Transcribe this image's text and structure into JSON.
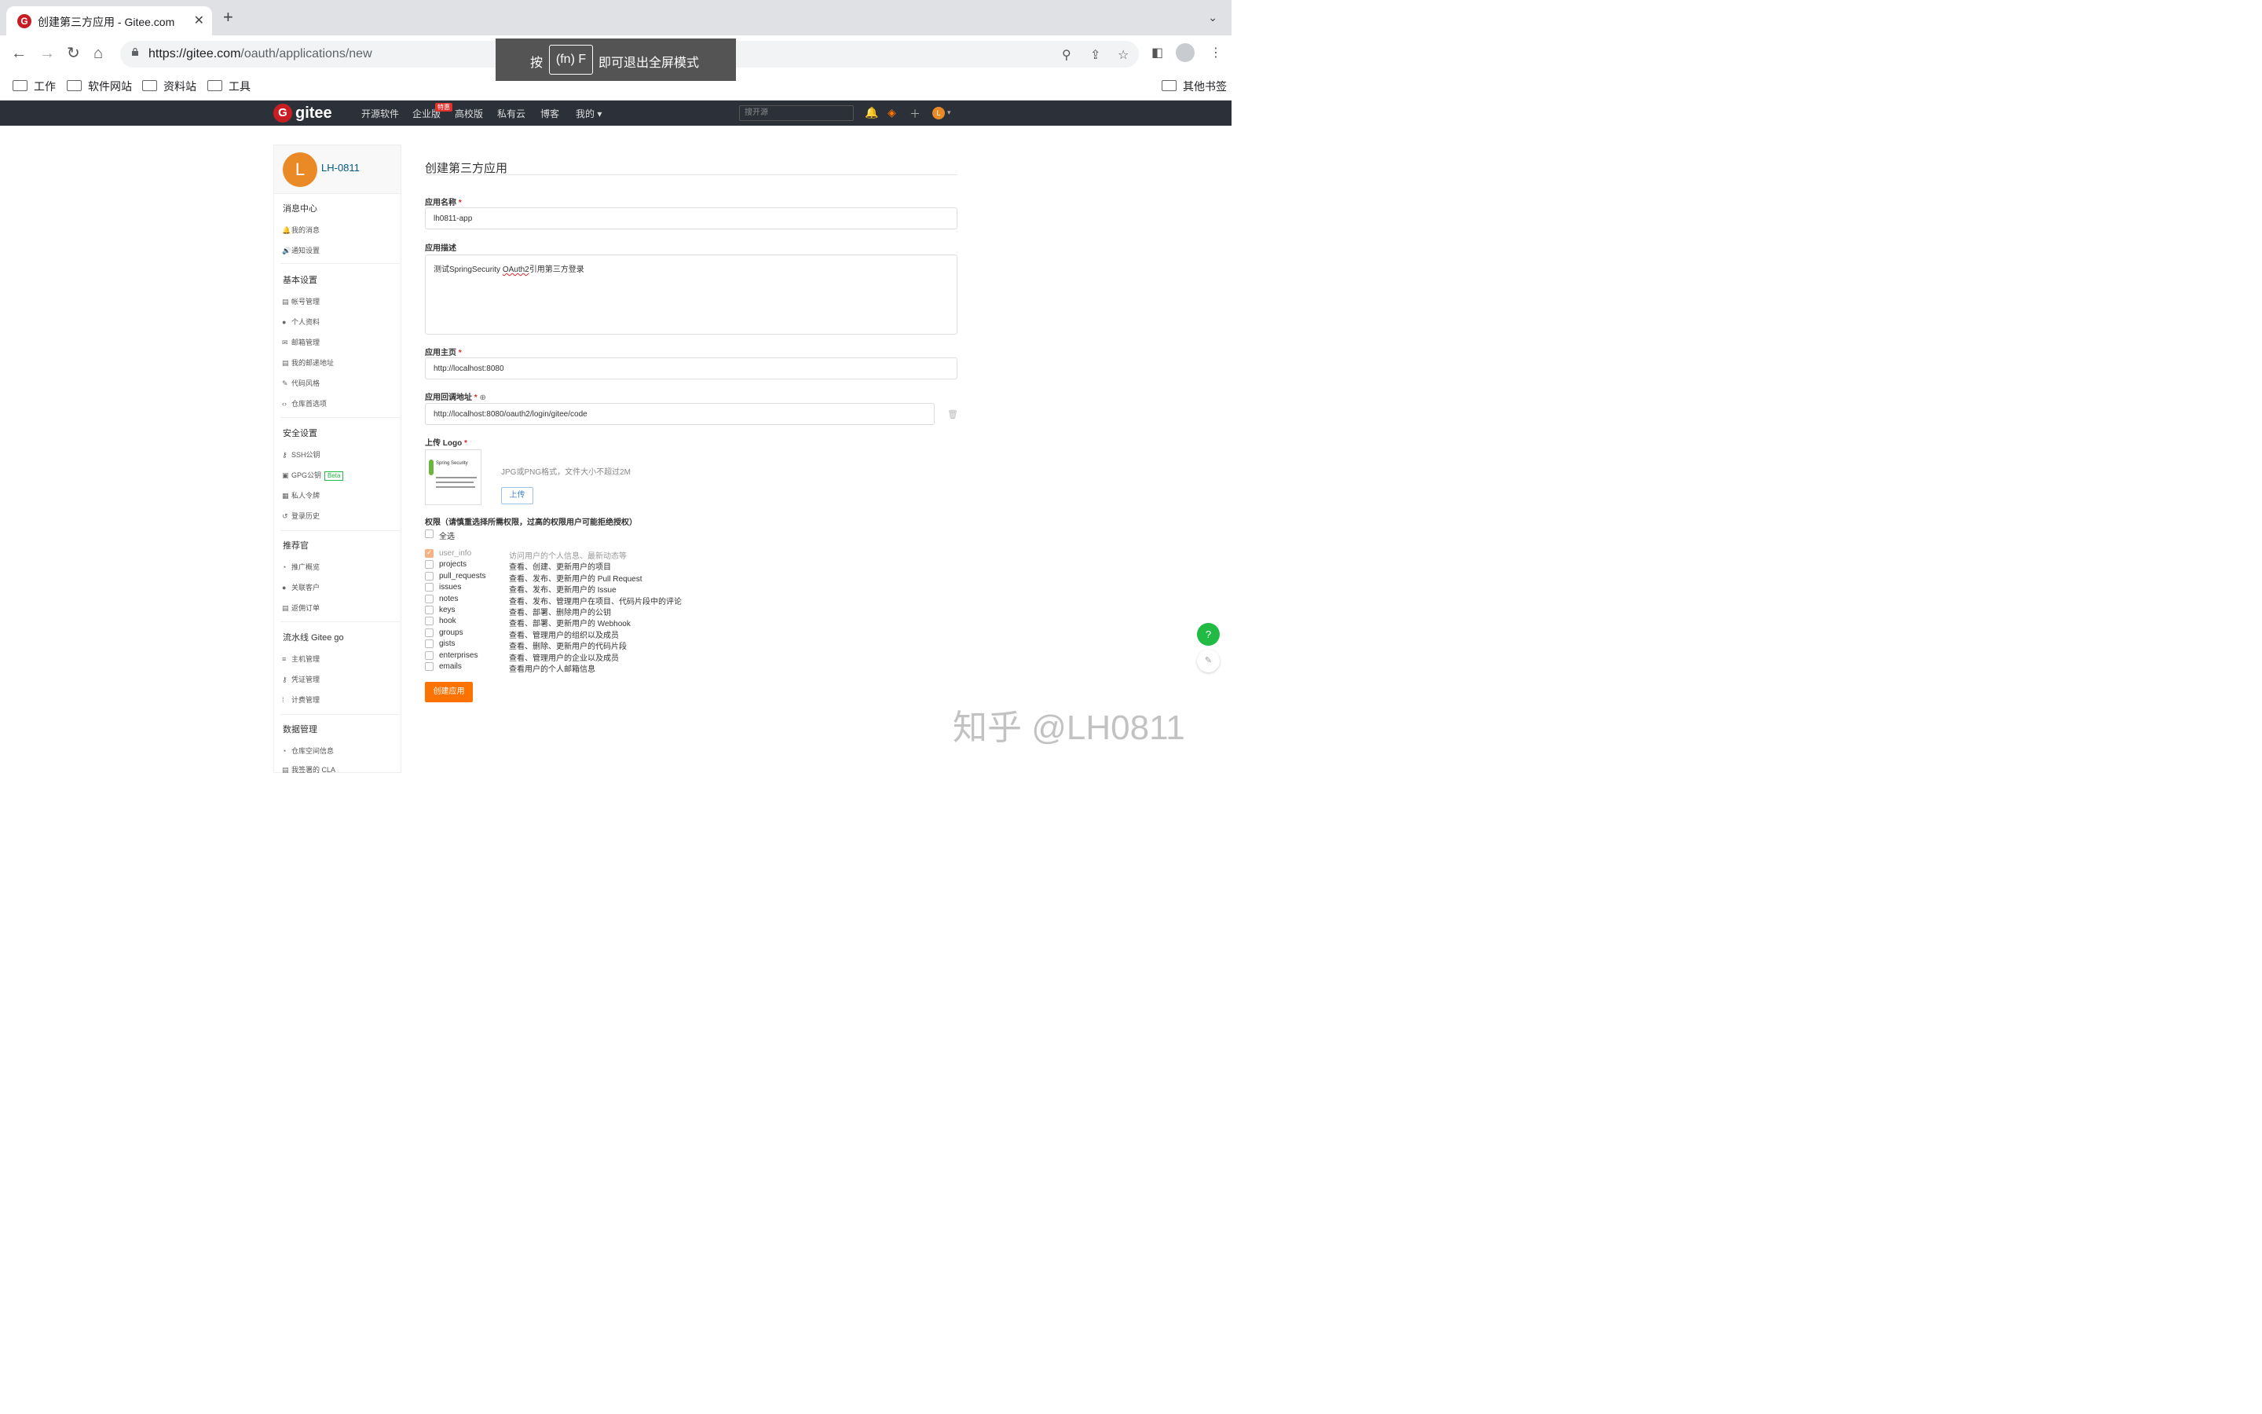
{
  "browser": {
    "tab_title": "创建第三方应用 - Gitee.com",
    "url_host": "https://gitee.com",
    "url_path": "/oauth/applications/new",
    "bookmarks": [
      "工作",
      "软件网站",
      "资料站",
      "工具"
    ],
    "other_bookmarks": "其他书签",
    "fullscreen_prefix": "按",
    "fullscreen_key": "(fn) F",
    "fullscreen_suffix": "即可退出全屏模式"
  },
  "header": {
    "logo": "gitee",
    "nav": [
      "开源软件",
      "企业版",
      "高校版",
      "私有云",
      "博客",
      "我的"
    ],
    "hot_badge": "特惠",
    "search_placeholder": "搜开源",
    "avatar_letter": "L"
  },
  "sidebar": {
    "avatar_letter": "L",
    "username": "LH-0811",
    "sections": [
      {
        "title": "消息中心",
        "items": [
          {
            "icon": "bell-icon",
            "glyph": "🔔",
            "label": "我的消息"
          },
          {
            "icon": "speaker-icon",
            "glyph": "🔊",
            "label": "通知设置"
          }
        ]
      },
      {
        "title": "基本设置",
        "items": [
          {
            "icon": "idcard-icon",
            "glyph": "▤",
            "label": "帐号管理"
          },
          {
            "icon": "user-icon",
            "glyph": "●",
            "label": "个人资料"
          },
          {
            "icon": "mail-icon",
            "glyph": "✉",
            "label": "邮箱管理"
          },
          {
            "icon": "address-icon",
            "glyph": "▤",
            "label": "我的邮递地址"
          },
          {
            "icon": "brush-icon",
            "glyph": "✎",
            "label": "代码风格"
          },
          {
            "icon": "code-icon",
            "glyph": "‹›",
            "label": "仓库首选项"
          }
        ]
      },
      {
        "title": "安全设置",
        "items": [
          {
            "icon": "key-icon",
            "glyph": "⚷",
            "label": "SSH公钥"
          },
          {
            "icon": "lock-icon",
            "glyph": "▣",
            "label": "GPG公钥",
            "badge": "Beta"
          },
          {
            "icon": "token-icon",
            "glyph": "▦",
            "label": "私人令牌"
          },
          {
            "icon": "history-icon",
            "glyph": "↺",
            "label": "登录历史"
          }
        ]
      },
      {
        "title": "推荐官",
        "items": [
          {
            "icon": "chart-icon",
            "glyph": "◔",
            "label": "推广概览"
          },
          {
            "icon": "users-icon",
            "glyph": "●",
            "label": "关联客户"
          },
          {
            "icon": "order-icon",
            "glyph": "▤",
            "label": "返佣订单"
          }
        ]
      },
      {
        "title": "流水线 Gitee go",
        "items": [
          {
            "icon": "server-icon",
            "glyph": "≡",
            "label": "主机管理"
          },
          {
            "icon": "key-icon",
            "glyph": "⚷",
            "label": "凭证管理"
          },
          {
            "icon": "billing-icon",
            "glyph": "⁞",
            "label": "计费管理"
          }
        ]
      },
      {
        "title": "数据管理",
        "items": [
          {
            "icon": "pie-icon",
            "glyph": "◔",
            "label": "仓库空间信息"
          },
          {
            "icon": "doc-icon",
            "glyph": "▤",
            "label": "我签署的 CLA"
          }
        ]
      }
    ]
  },
  "form": {
    "page_title": "创建第三方应用",
    "name_label": "应用名称",
    "name_value": "lh0811-app",
    "desc_label": "应用描述",
    "desc_value_a": "测试SpringSecurity ",
    "desc_value_b": "OAuth2",
    "desc_value_c": "引用第三方登录",
    "homepage_label": "应用主页",
    "homepage_value": "http://localhost:8080",
    "callback_label": "应用回调地址",
    "callback_value": "http://localhost:8080/oauth2/login/gitee/code",
    "logo_label": "上传 Logo",
    "logo_image_text": "Spring Security",
    "upload_hint": "JPG或PNG格式，文件大小不超过2M",
    "upload_button": "上传",
    "perm_title": "权限（请慎重选择所需权限，过高的权限用户可能拒绝授权）",
    "select_all": "全选",
    "permissions": [
      {
        "name": "user_info",
        "desc": "访问用户的个人信息、最新动态等",
        "checked": true
      },
      {
        "name": "projects",
        "desc": "查看、创建、更新用户的项目",
        "checked": false
      },
      {
        "name": "pull_requests",
        "desc": "查看、发布、更新用户的 Pull Request",
        "checked": false
      },
      {
        "name": "issues",
        "desc": "查看、发布、更新用户的 Issue",
        "checked": false
      },
      {
        "name": "notes",
        "desc": "查看、发布、管理用户在项目、代码片段中的评论",
        "checked": false
      },
      {
        "name": "keys",
        "desc": "查看、部署、删除用户的公钥",
        "checked": false
      },
      {
        "name": "hook",
        "desc": "查看、部署、更新用户的 Webhook",
        "checked": false
      },
      {
        "name": "groups",
        "desc": "查看、管理用户的组织以及成员",
        "checked": false
      },
      {
        "name": "gists",
        "desc": "查看、删除、更新用户的代码片段",
        "checked": false
      },
      {
        "name": "enterprises",
        "desc": "查看、管理用户的企业以及成员",
        "checked": false
      },
      {
        "name": "emails",
        "desc": "查看用户的个人邮箱信息",
        "checked": false
      }
    ],
    "submit": "创建应用"
  },
  "float": {
    "help": "?"
  },
  "watermark": "知乎 @LH0811",
  "colors": {
    "gitee_red": "#c71d23",
    "submit_orange": "#fe7300",
    "header_bg": "#2c3038",
    "avatar_orange": "#e98a27"
  }
}
